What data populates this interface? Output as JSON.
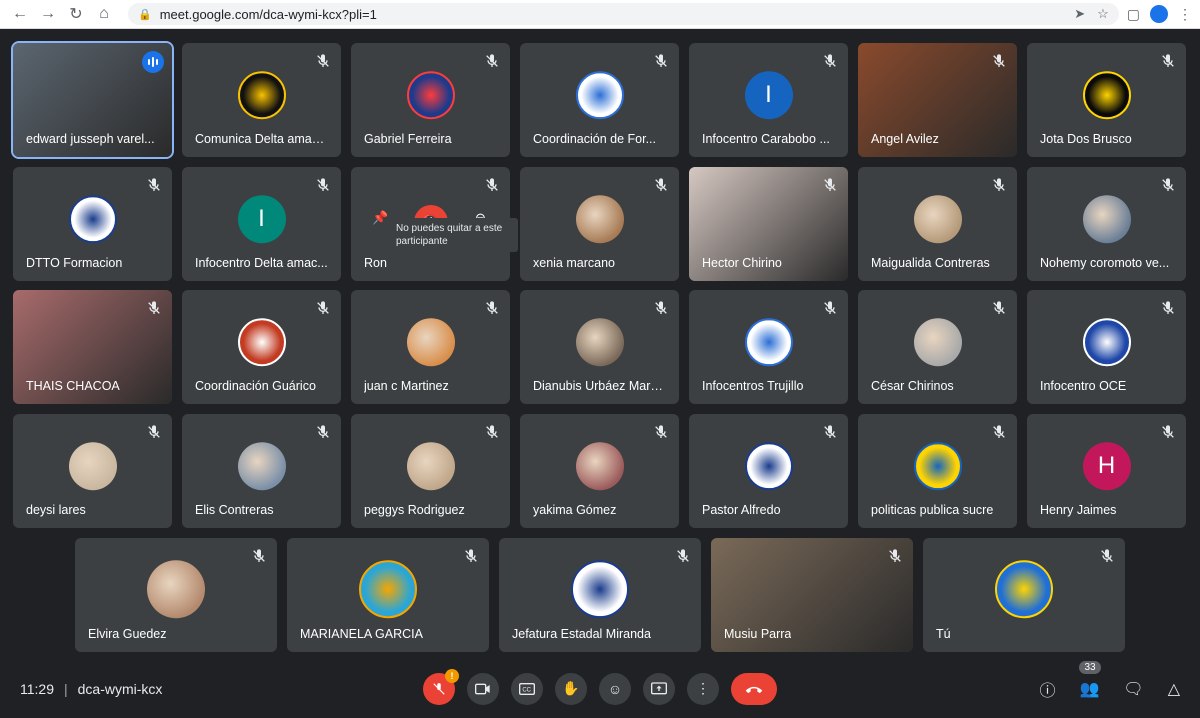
{
  "browser": {
    "url": "meet.google.com/dca-wymi-kcx?pli=1"
  },
  "tooltip": "No puedes quitar a este participante",
  "participants": [
    {
      "name": "edward jusseph varel...",
      "kind": "video",
      "bg": "#5b6670",
      "speaking": true
    },
    {
      "name": "Comunica Delta amac...",
      "kind": "logo",
      "bg": "#111111",
      "fg": "#f9c200"
    },
    {
      "name": "Gabriel Ferreira",
      "kind": "logo",
      "bg": "#1e3a8a",
      "fg": "#ff3b3b"
    },
    {
      "name": "Coordinación de For...",
      "kind": "logo",
      "bg": "#ffffff",
      "fg": "#2b6fd6"
    },
    {
      "name": "Infocentro Carabobo ...",
      "kind": "letter",
      "letter": "I",
      "bg": "#1565c0"
    },
    {
      "name": "Angel Avilez",
      "kind": "video",
      "bg": "#8a4a2c"
    },
    {
      "name": "Jota Dos Brusco",
      "kind": "logo",
      "bg": "#0a0a0a",
      "fg": "#ffd400"
    },
    {
      "name": "DTTO Formacion",
      "kind": "logo",
      "bg": "#ffffff",
      "fg": "#1a3c8c"
    },
    {
      "name": "Infocentro Delta amac...",
      "kind": "letter",
      "letter": "I",
      "bg": "#00897b"
    },
    {
      "name": "Ron",
      "kind": "hover",
      "bg": "#3c4043"
    },
    {
      "name": "xenia marcano",
      "kind": "photo",
      "bg": "#a77b55"
    },
    {
      "name": "Hector Chirino",
      "kind": "video",
      "bg": "#d6c8c2"
    },
    {
      "name": "Maigualida Contreras",
      "kind": "photo",
      "bg": "#b59a79"
    },
    {
      "name": "Nohemy coromoto ve...",
      "kind": "photo",
      "bg": "#6b7f97"
    },
    {
      "name": "THAIS CHACOA",
      "kind": "video",
      "bg": "#a86b6b"
    },
    {
      "name": "Coordinación Guárico",
      "kind": "logo",
      "bg": "#c23b22",
      "fg": "#ffffff"
    },
    {
      "name": "juan c Martinez",
      "kind": "photo",
      "bg": "#d98e4b"
    },
    {
      "name": "Dianubis Urbáez Marc...",
      "kind": "photo",
      "bg": "#7b6a5a"
    },
    {
      "name": "Infocentros Trujillo",
      "kind": "logo",
      "bg": "#ffffff",
      "fg": "#2b6fd6"
    },
    {
      "name": "César Chirinos",
      "kind": "photo",
      "bg": "#a9a9a9"
    },
    {
      "name": "Infocentro OCE",
      "kind": "logo",
      "bg": "#1f47a8",
      "fg": "#ffffff"
    },
    {
      "name": "deysi lares",
      "kind": "photo",
      "bg": "#c9b7a0"
    },
    {
      "name": "Elis Contreras",
      "kind": "photo",
      "bg": "#7a8fa8"
    },
    {
      "name": "peggys Rodriguez",
      "kind": "photo",
      "bg": "#c0a78a"
    },
    {
      "name": "yakima Gómez",
      "kind": "photo",
      "bg": "#9c5b5b"
    },
    {
      "name": "Pastor Alfredo",
      "kind": "logo",
      "bg": "#ffffff",
      "fg": "#1a3c8c"
    },
    {
      "name": "politicas publica sucre",
      "kind": "logo",
      "bg": "#ffd400",
      "fg": "#1565c0"
    },
    {
      "name": "Henry Jaimes",
      "kind": "letter",
      "letter": "H",
      "bg": "#c2185b"
    },
    {
      "name": "Elvira Guedez",
      "kind": "photo",
      "bg": "#b48a6e"
    },
    {
      "name": "MARIANELA GARCIA",
      "kind": "logo",
      "bg": "#2aa6d6",
      "fg": "#f7a600"
    },
    {
      "name": "Jefatura Estadal Miranda",
      "kind": "logo",
      "bg": "#ffffff",
      "fg": "#1a3c8c"
    },
    {
      "name": "Musiu Parra",
      "kind": "video",
      "bg": "#7a6a58"
    },
    {
      "name": "Tú",
      "kind": "logo",
      "bg": "#1f6fd6",
      "fg": "#ffd400"
    }
  ],
  "meeting": {
    "time": "11:29",
    "code": "dca-wymi-kcx",
    "participant_count": "33",
    "mic_badge": "!"
  },
  "colors": {
    "background": "#202124",
    "tile": "#3c4043",
    "end_call": "#ea4335",
    "active_outline": "#8ab4f8"
  }
}
